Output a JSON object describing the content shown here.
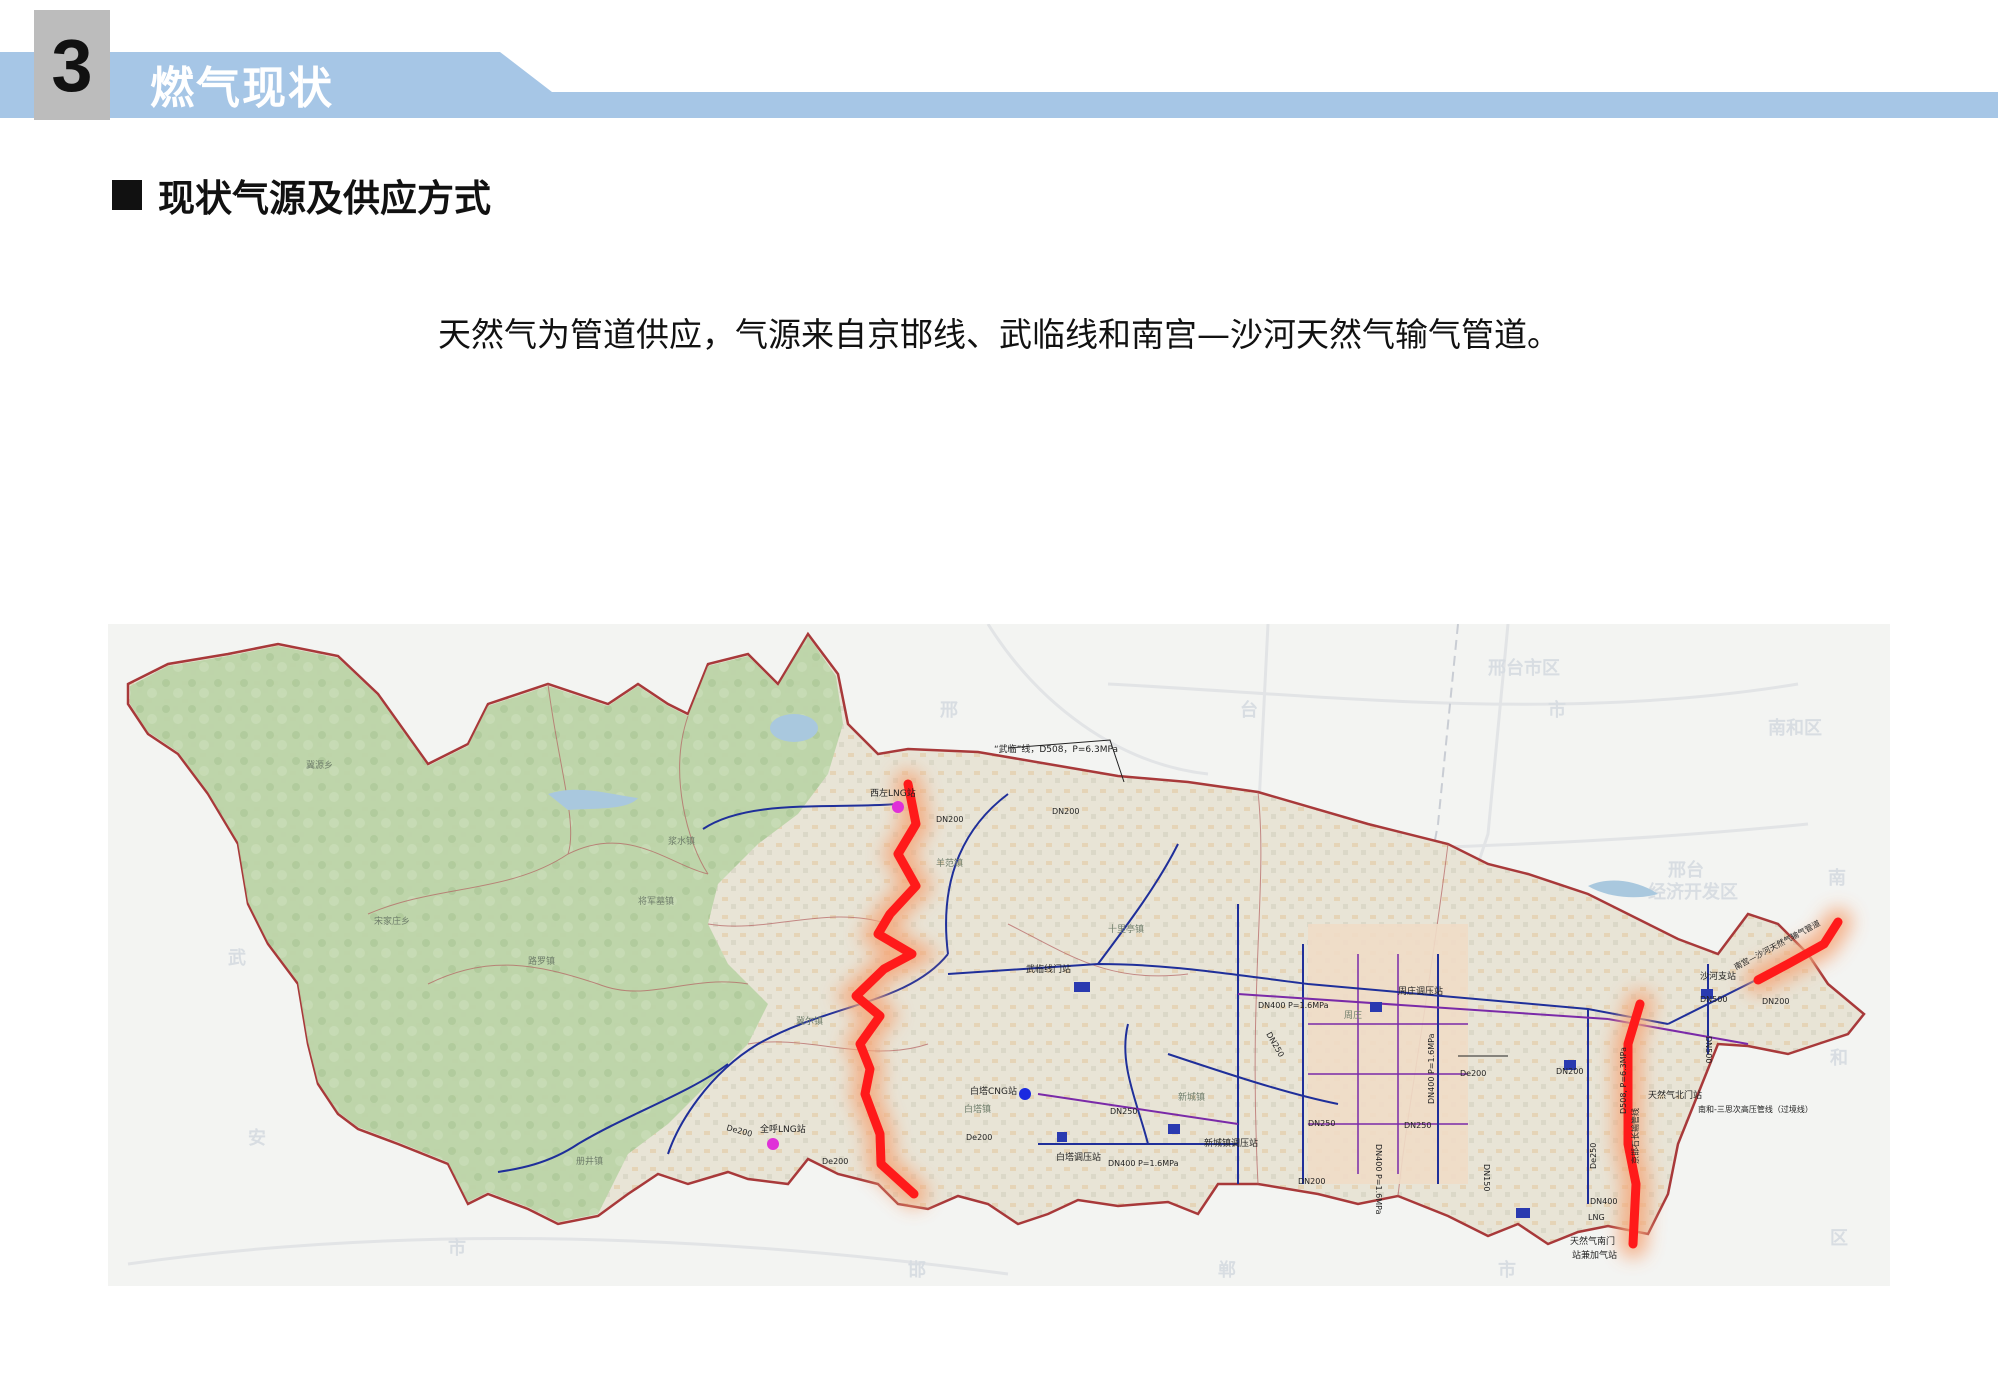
{
  "header": {
    "section_number": "3",
    "section_title": "燃气现状"
  },
  "subheading": "现状气源及供应方式",
  "description": "天然气为管道供应，气源来自京邯线、武临线和南宫—沙河天然气输气管道。",
  "map": {
    "pipeline_labels": {
      "wulin": "“武临”线，D508，P=6.3MPa",
      "nangong": "南宫—沙河天然气输气管道",
      "jinghan": "京邯石长输管线",
      "nanhe": "南和-三思次高压管线（过境线）"
    },
    "stations": {
      "xizuo_lng": "西左LNG站",
      "quanhu_lng": "全呼LNG站",
      "baita_cng": "白塔CNG站",
      "wulin_gate": "武临线门站",
      "baita_reg": "白塔调压站",
      "xincheng_reg": "新城镇调压站",
      "zhouzhuang_reg": "周庄调压站",
      "shahe_branch": "沙河支站",
      "north_gate": "天然气北门站",
      "south_gate_1": "天然气南门",
      "south_gate_2": "站兼加气站",
      "lng_tag": "LNG"
    },
    "pipe_specs": {
      "xizuo_dn200": "DN200",
      "wulin_dn200": "DN200",
      "quanhu_de200_a": "De200",
      "quanhu_de200_b": "De200",
      "baita_de200": "De200",
      "dn400_p16_a": "DN400 P=1.6MPa",
      "dn400_p16_b": "DN400 P=1.6MPa",
      "dn400_p16_c": "DN400 P=1.6MPa",
      "dn250_a": "DN250",
      "dn250_b": "DN250",
      "dn250_c": "DN250",
      "dn250_d": "DN250",
      "de200_city": "De200",
      "dn400_p16_v": "DN400 P=1.6MPa",
      "dn150": "DN150",
      "dn200_a": "DN200",
      "dn200_b": "DN200",
      "de250": "De250",
      "dn400_s": "DN400",
      "dn500_a": "DN500",
      "dn500_b": "DN500",
      "dn200_east": "DN200",
      "d508": "D508, P=6.3MPa"
    },
    "towns": {
      "t1": "冀源乡",
      "t2": "宋家庄乡",
      "t3": "路罗镇",
      "t4": "将军墓镇",
      "t5": "浆水镇",
      "t6": "冀尔镇",
      "t7": "新城镇",
      "t8": "羊范镇",
      "t9": "十里亭镇",
      "t10": "白塔镇",
      "t11": "册井镇",
      "t12": "周庄"
    },
    "background_labels": {
      "b1": "邢",
      "b2": "台",
      "b3": "市",
      "b4": "邢台市区",
      "b5": "南和区",
      "b6": "邢台",
      "b7": "经济开发区",
      "b8": "邯",
      "b9": "郸",
      "b10": "市",
      "b11": "南",
      "b12": "和",
      "b13": "区",
      "b14": "武",
      "b15": "安",
      "b16": "市"
    },
    "colors": {
      "terrain_green": "#bcd4a8",
      "boundary": "#a8393a",
      "gas_main": "#ff1a1a",
      "gas_glow": "#f5a678",
      "pipeline_blue": "#1f2f9a",
      "branch_purple": "#7a2aa8",
      "lng_station": "#e030d8",
      "cng_station": "#1a2ae0"
    }
  }
}
